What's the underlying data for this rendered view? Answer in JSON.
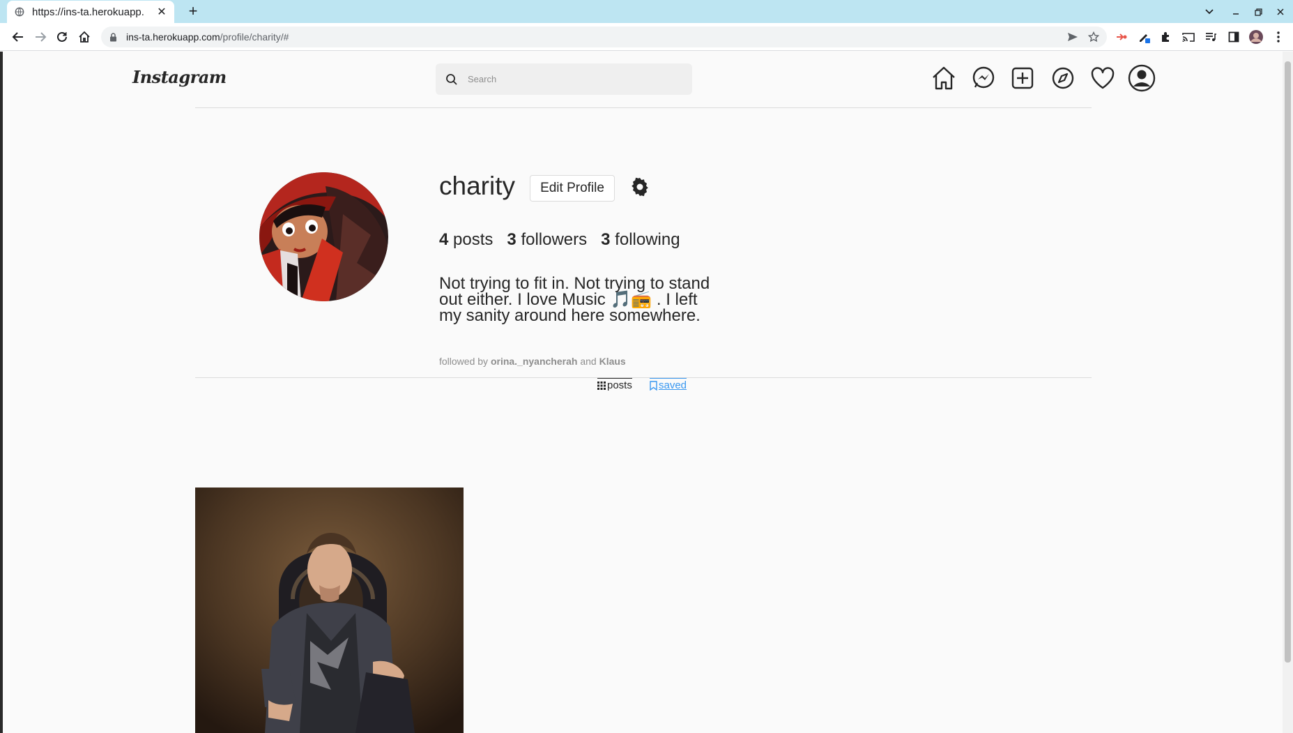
{
  "browser": {
    "tab_title": "https://ins-ta.herokuapp.",
    "url_host": "ins-ta.herokuapp.com",
    "url_path": "/profile/charity/#"
  },
  "app": {
    "logo_text": "Instagram",
    "search_placeholder": "Search"
  },
  "profile": {
    "username": "charity",
    "edit_button": "Edit Profile",
    "stats": [
      {
        "count": "4",
        "label": "posts"
      },
      {
        "count": "3",
        "label": "followers"
      },
      {
        "count": "3",
        "label": "following"
      }
    ],
    "bio": "Not trying to fit in. Not trying to stand out either. I love Music 🎵📻 . I left my sanity around here somewhere.",
    "followed_by_prefix": "followed by",
    "followed_by_user1": "orina._nyancherah",
    "followed_by_and": "and",
    "followed_by_user2": "Klaus"
  },
  "profile_tabs": {
    "posts_label": "posts",
    "saved_label": "saved"
  },
  "colors": {
    "tabbar": "#bde5f2",
    "link_blue": "#3897f0",
    "page_bg": "#fafafa"
  }
}
